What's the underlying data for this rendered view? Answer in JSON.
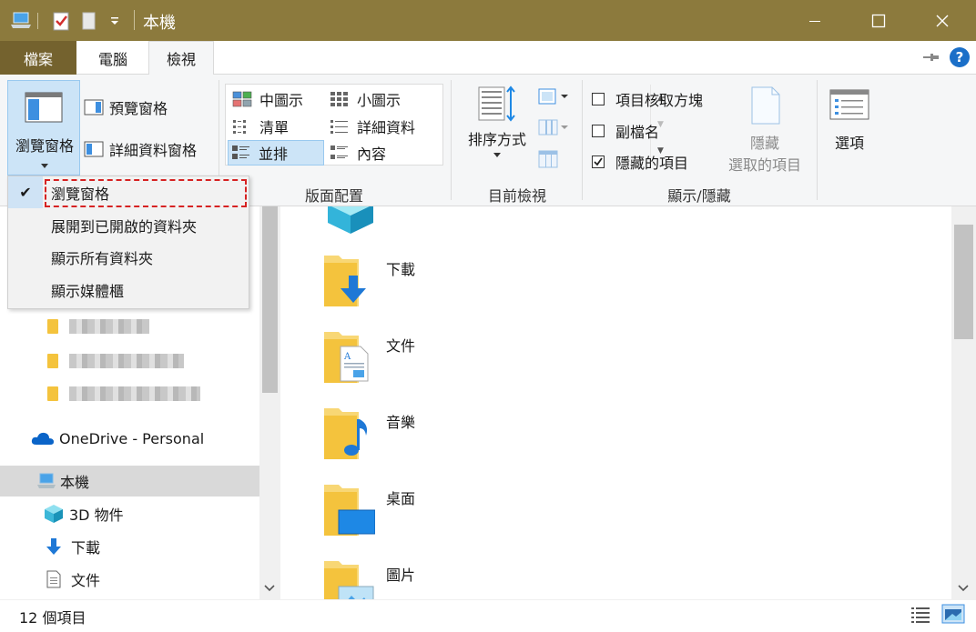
{
  "window": {
    "title": "本機",
    "minimize_glyph": "—",
    "maximize_glyph": "☐",
    "close_glyph": "✕"
  },
  "tabs": {
    "file": "檔案",
    "computer": "電腦",
    "view": "檢視"
  },
  "help_glyph": "?",
  "ribbon": {
    "panes": {
      "navigation_pane": "瀏覽窗格",
      "preview_pane": "預覽窗格",
      "details_pane": "詳細資料窗格"
    },
    "layout": {
      "label": "版面配置",
      "items": [
        "中圖示",
        "小圖示",
        "清單",
        "詳細資料",
        "並排",
        "內容"
      ],
      "selected": "並排"
    },
    "current_view": {
      "label": "目前檢視",
      "sort_by": "排序方式"
    },
    "show_hide": {
      "label": "顯示/隱藏",
      "item_checkboxes": "項目核取方塊",
      "item_checkboxes_checked": false,
      "file_extensions": "副檔名",
      "file_extensions_checked": false,
      "hidden_items": "隱藏的項目",
      "hidden_items_checked": true,
      "hide_selected_line1": "隱藏",
      "hide_selected_line2": "選取的項目"
    },
    "options": "選項"
  },
  "dropdown": {
    "items": [
      "瀏覽窗格",
      "展開到已開啟的資料夾",
      "顯示所有資料夾",
      "顯示媒體櫃"
    ],
    "checked_index": 0,
    "check_glyph": "✔"
  },
  "nav": {
    "onedrive": "OneDrive - Personal",
    "this_pc": "本機",
    "objects3d": "3D 物件",
    "downloads": "下載",
    "documents": "文件"
  },
  "content": {
    "items": [
      "下載",
      "文件",
      "音樂",
      "桌面",
      "圖片"
    ]
  },
  "status": {
    "count": "12 個項目"
  },
  "colors": {
    "titlebar": "#8c7a3d",
    "file_tab": "#74622e",
    "selection": "#cce4f7",
    "highlight_border": "#d62222"
  }
}
